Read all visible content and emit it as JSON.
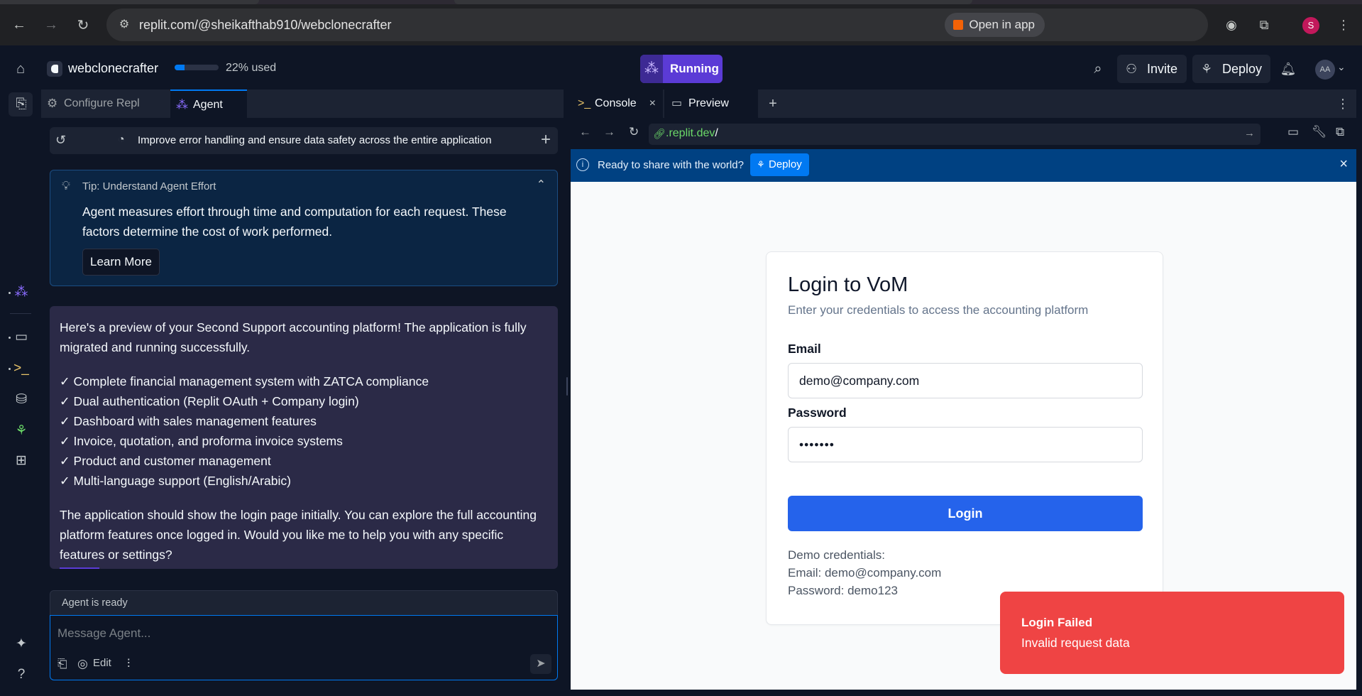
{
  "browser": {
    "url": "replit.com/@sheikafthab910/webclonecrafter",
    "open_in_app": "Open in app",
    "profile_initial": "S"
  },
  "topbar": {
    "repl_name": "webclonecrafter",
    "usage_fraction": 0.22,
    "usage_label": "22% used",
    "run_status": "Running",
    "invite_label": "Invite",
    "deploy_label": "Deploy",
    "avatar_initials": "AA"
  },
  "left_tabs": [
    {
      "label": "Configure Repl",
      "icon": "gear-icon"
    },
    {
      "label": "Agent",
      "icon": "agent-icon"
    }
  ],
  "history": {
    "item": "Improve error handling and ensure data safety across the entire application"
  },
  "tip": {
    "title": "Tip: Understand Agent Effort",
    "body": "Agent measures effort through time and computation for each request. These factors determine the cost of work performed.",
    "button": "Learn More"
  },
  "message": {
    "intro": "Here's a preview of your Second Support accounting platform! The application is fully migrated and running successfully.",
    "items": [
      "✓ Complete financial management system with ZATCA compliance",
      "✓ Dual authentication (Replit OAuth + Company login)",
      "✓ Dashboard with sales management features",
      "✓ Invoice, quotation, and proforma invoice systems",
      "✓ Product and customer management",
      "✓ Multi-language support (English/Arabic)"
    ],
    "outro": "The application should show the login page initially. You can explore the full accounting platform features once logged in. Would you like me to help you with any specific features or settings?"
  },
  "agent_status": "Agent is ready",
  "composer": {
    "placeholder": "Message Agent...",
    "edit_label": "Edit"
  },
  "right_tabs": [
    {
      "label": "Console"
    },
    {
      "label": "Preview"
    }
  ],
  "preview": {
    "url_domain": ".replit.dev",
    "url_path": "/",
    "banner_text": "Ready to share with the world?",
    "banner_button": "Deploy"
  },
  "login": {
    "title": "Login to VoM",
    "subtitle": "Enter your credentials to access the accounting platform",
    "email_label": "Email",
    "email_value": "demo@company.com",
    "password_label": "Password",
    "password_value": "•••••••",
    "button": "Login",
    "demo_heading": "Demo credentials:",
    "demo_email": "Email: demo@company.com",
    "demo_password": "Password: demo123"
  },
  "toast": {
    "title": "Login Failed",
    "description": "Invalid request data"
  },
  "colors": {
    "accent": "#0079f2",
    "running": "#5b3bd6",
    "login_button": "#2563eb",
    "toast": "#ef4444"
  }
}
